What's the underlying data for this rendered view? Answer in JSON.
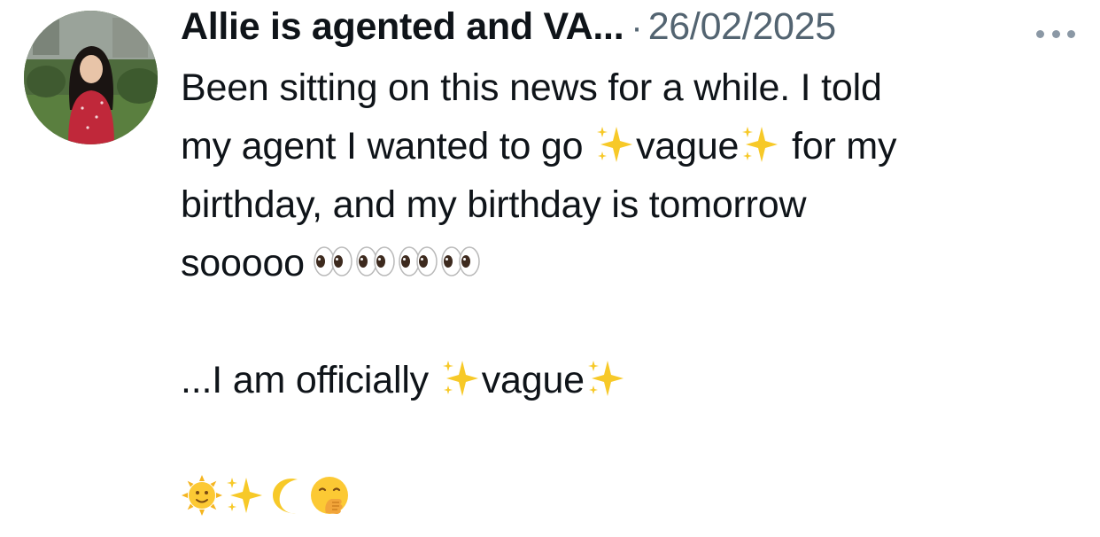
{
  "tweet": {
    "display_name": "Allie is agented and VA...",
    "separator": "·",
    "timestamp": "26/02/2025",
    "text": {
      "line1": "Been sitting on this news for a while. I told",
      "line2_a": "my agent I wanted to go ",
      "line2_b": "vague",
      "line2_c": " for my",
      "line3": "birthday, and my birthday is tomorrow",
      "line4": "sooooo",
      "line6_a": "...I am officially ",
      "line6_b": "vague"
    },
    "emoji": {
      "sparkles": "sparkles-icon",
      "eyes": "eyes-icon",
      "sun": "sun-with-face-icon",
      "moon": "crescent-moon-icon",
      "smirk": "face-with-hand-over-mouth-icon"
    }
  }
}
